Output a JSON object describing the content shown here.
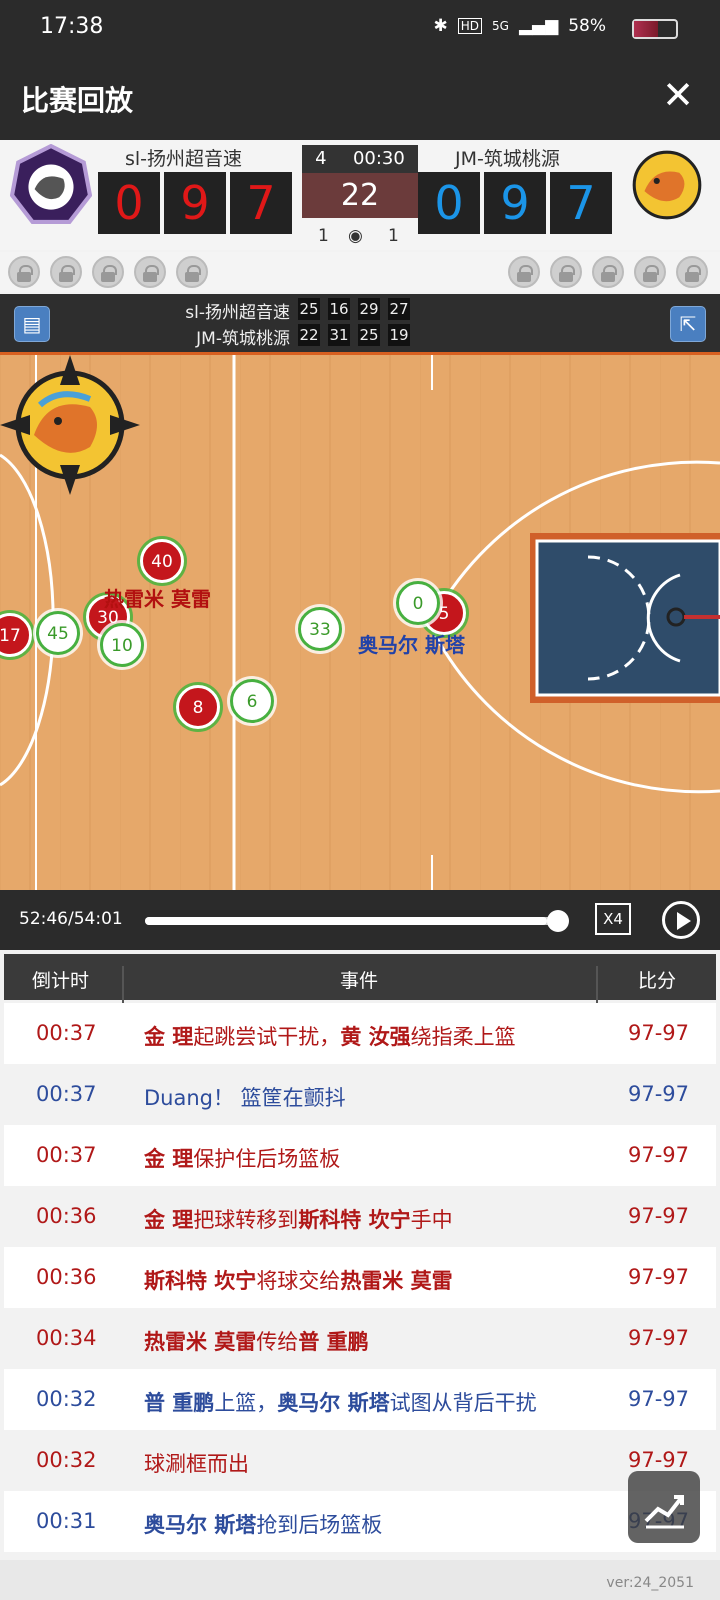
{
  "status": {
    "time": "17:38",
    "battery": "58%",
    "network": "5G",
    "hd": "HD"
  },
  "header": {
    "title": "比赛回放",
    "close_label": "✕"
  },
  "score": {
    "home": {
      "name": "sl-扬州超音速",
      "digits": [
        "0",
        "9",
        "7"
      ],
      "fouls": "1",
      "color": "#e01818"
    },
    "away": {
      "name": "JM-筑城桃源",
      "digits": [
        "0",
        "9",
        "7"
      ],
      "fouls": "1",
      "color": "#1b95e8"
    },
    "quarter": "4",
    "clock": "00:30",
    "shot_clock": "22"
  },
  "quarters": {
    "home": {
      "name": "sl-扬州超音速",
      "values": [
        "25",
        "16",
        "29",
        "27"
      ]
    },
    "away": {
      "name": "JM-筑城桃源",
      "values": [
        "22",
        "31",
        "25",
        "19"
      ]
    }
  },
  "court": {
    "players": [
      {
        "number": "40",
        "team": "red"
      },
      {
        "number": "30",
        "team": "red"
      },
      {
        "number": "17",
        "team": "red"
      },
      {
        "number": "45",
        "team": "green"
      },
      {
        "number": "10",
        "team": "green"
      },
      {
        "number": "33",
        "team": "green"
      },
      {
        "number": "8",
        "team": "red"
      },
      {
        "number": "6",
        "team": "green"
      },
      {
        "number": "5",
        "team": "red"
      },
      {
        "number": "0",
        "team": "green"
      }
    ],
    "labels": {
      "home_player": "热雷米 莫雷",
      "away_player": "奥马尔 斯塔"
    }
  },
  "playback": {
    "position": "52:46/54:01",
    "speed": "X4",
    "progress": 0.97
  },
  "table": {
    "headers": {
      "time": "倒计时",
      "event": "事件",
      "score": "比分"
    },
    "rows": [
      {
        "time": "00:37",
        "event_parts": [
          [
            "金 理",
            true
          ],
          [
            "起跳尝试干扰，",
            false
          ],
          [
            "黄 汝强",
            true
          ],
          [
            "绕指柔上篮",
            false
          ]
        ],
        "score": "97-97",
        "team": "red"
      },
      {
        "time": "00:37",
        "event_parts": [
          [
            "Duang！ 篮筐在颤抖",
            false
          ]
        ],
        "score": "97-97",
        "team": "blue"
      },
      {
        "time": "00:37",
        "event_parts": [
          [
            "金 理",
            true
          ],
          [
            "保护住后场篮板",
            false
          ]
        ],
        "score": "97-97",
        "team": "red"
      },
      {
        "time": "00:36",
        "event_parts": [
          [
            "金 理",
            true
          ],
          [
            "把球转移到",
            false
          ],
          [
            "斯科特 坎宁",
            true
          ],
          [
            "手中",
            false
          ]
        ],
        "score": "97-97",
        "team": "red"
      },
      {
        "time": "00:36",
        "event_parts": [
          [
            "斯科特 坎宁",
            true
          ],
          [
            "将球交给",
            false
          ],
          [
            "热雷米 莫雷",
            true
          ]
        ],
        "score": "97-97",
        "team": "red"
      },
      {
        "time": "00:34",
        "event_parts": [
          [
            "热雷米 莫雷",
            true
          ],
          [
            "传给",
            false
          ],
          [
            "普 重鹏",
            true
          ]
        ],
        "score": "97-97",
        "team": "red"
      },
      {
        "time": "00:32",
        "event_parts": [
          [
            "普 重鹏",
            true
          ],
          [
            "上篮，",
            false
          ],
          [
            "奥马尔 斯塔",
            true
          ],
          [
            "试图从背后干扰",
            false
          ]
        ],
        "score": "97-97",
        "team": "blue"
      },
      {
        "time": "00:32",
        "event_parts": [
          [
            "球涮框而出",
            false
          ]
        ],
        "score": "97-97",
        "team": "red"
      },
      {
        "time": "00:31",
        "event_parts": [
          [
            "奥马尔 斯塔",
            true
          ],
          [
            "抢到后场篮板",
            false
          ]
        ],
        "score": "97-97",
        "team": "blue"
      }
    ]
  },
  "footer": {
    "version": "ver:24_2051"
  }
}
